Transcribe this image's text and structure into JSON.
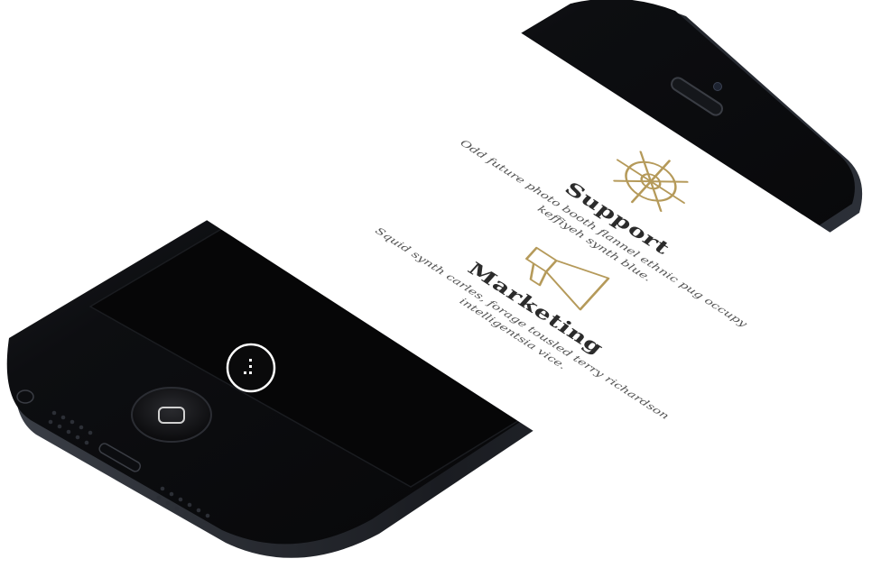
{
  "colors": {
    "accent": "#b59a5a",
    "phone_body": "#0b0c0e",
    "bezel": "#050506",
    "screen_bg": "#ffffff",
    "text_dark": "#2b2b2b",
    "text_muted": "#555555"
  },
  "features": [
    {
      "icon": "ship-wheel-icon",
      "title": "Support",
      "text": "Odd future photo booth flannel ethnic pug occupy keffiyeh synth blue."
    },
    {
      "icon": "megaphone-icon",
      "title": "Marketing",
      "text": "Squid synth carles, forage tousled terry richardson intelligentsia vice."
    }
  ],
  "menu_button": {
    "icon": "menu-dots-icon"
  }
}
